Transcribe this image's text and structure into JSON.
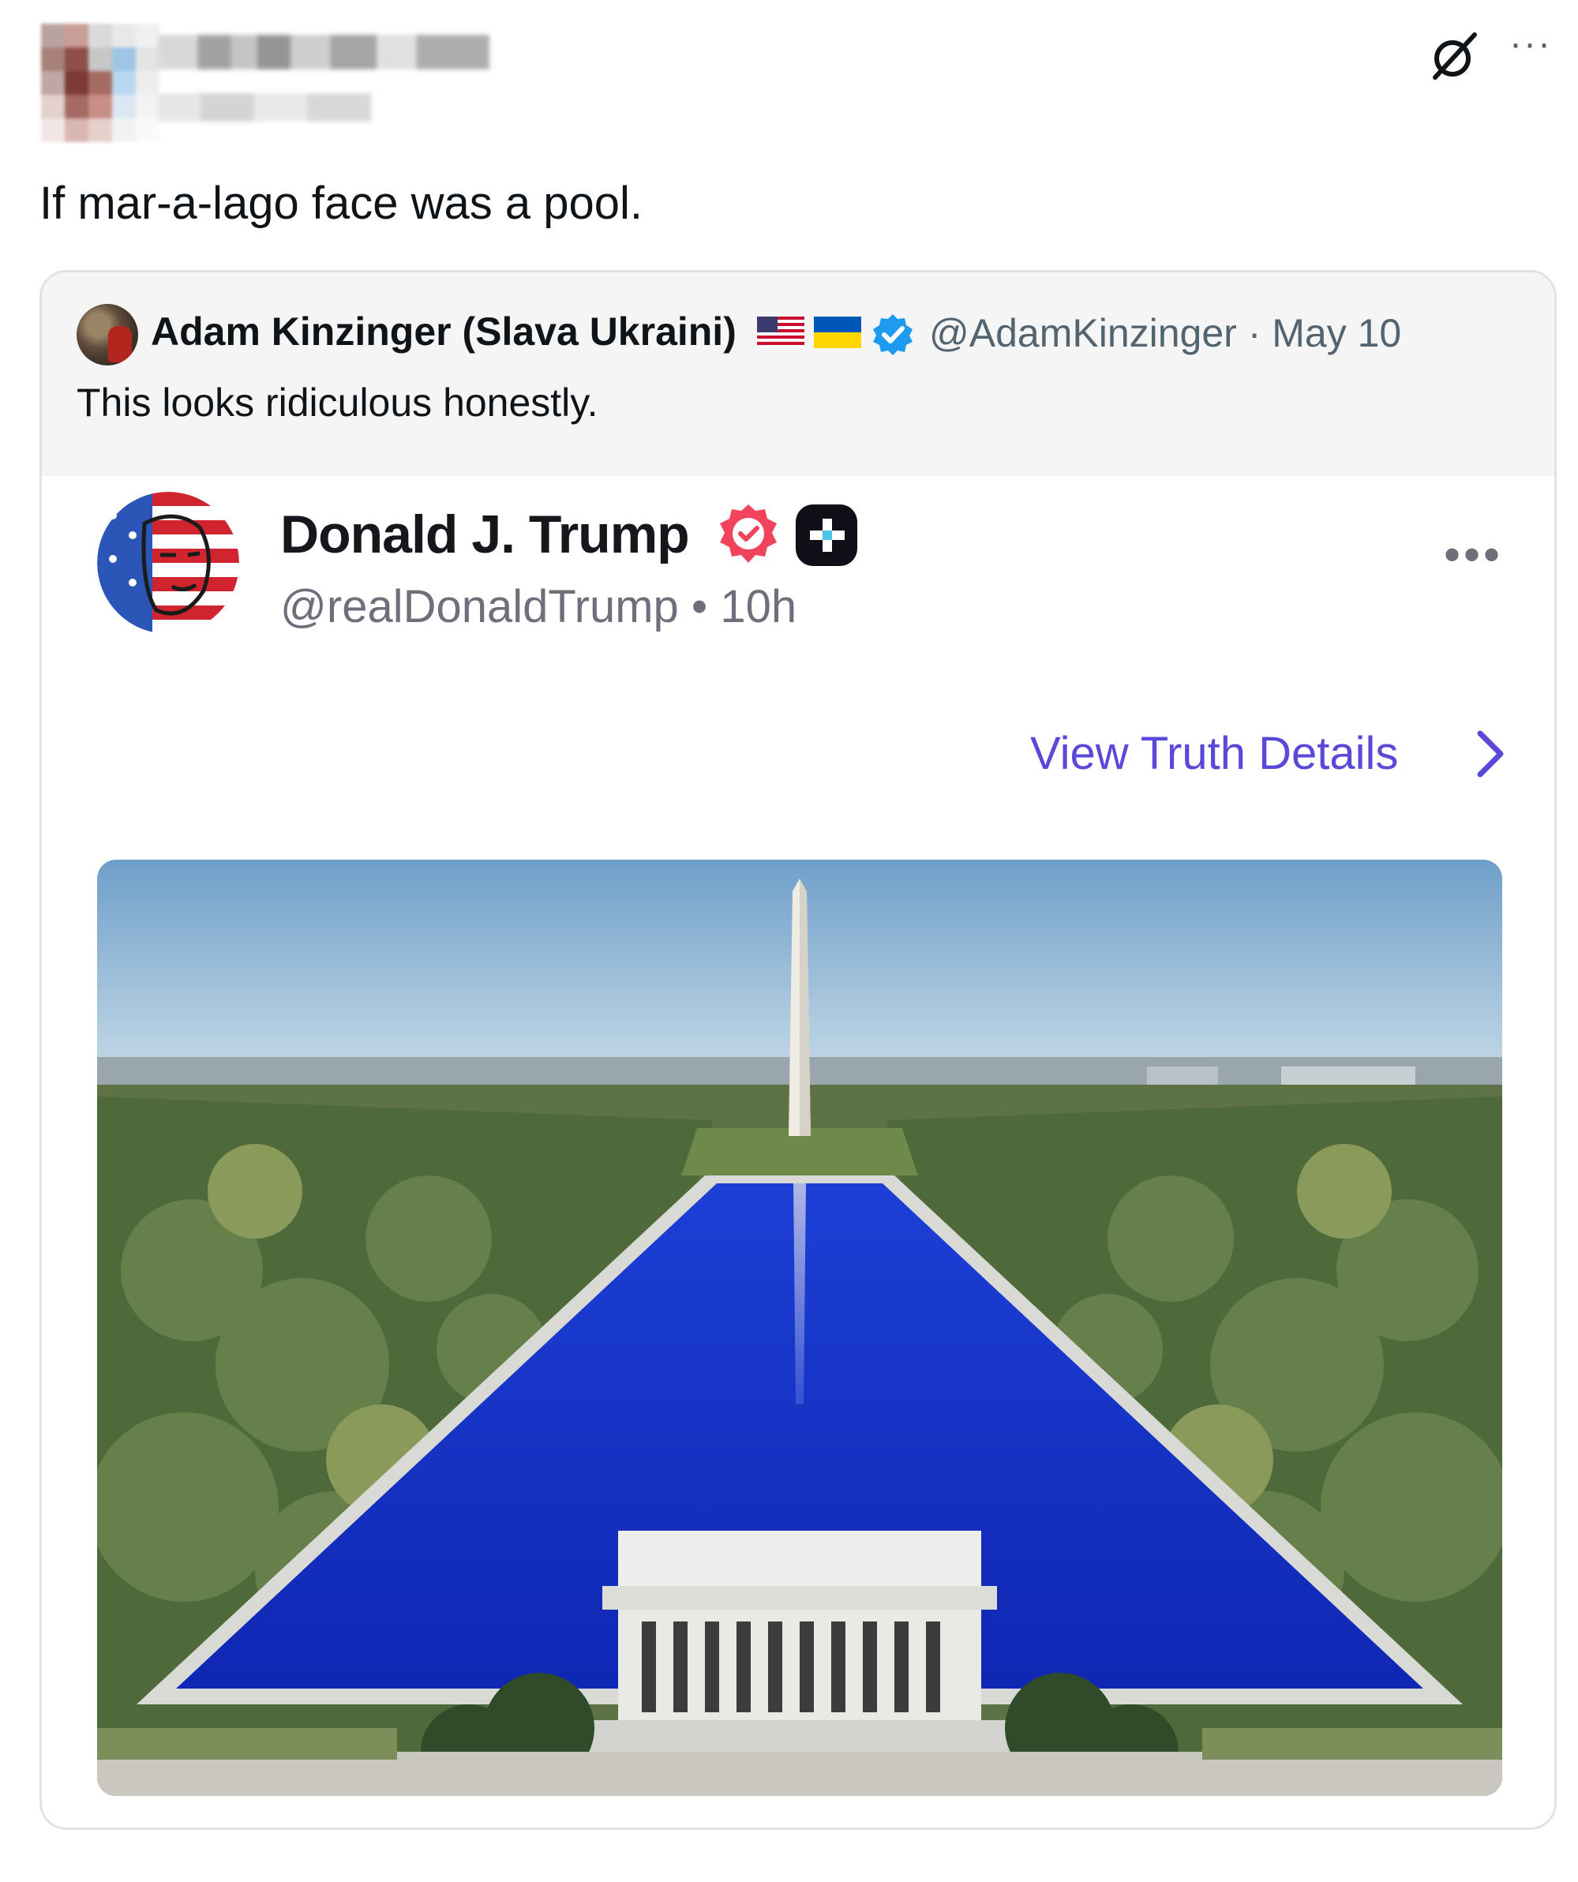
{
  "tweet": {
    "text": "If mar-a-lago face was a pool."
  },
  "quoted_tweet": {
    "author_name": "Adam Kinzinger (Slava Ukraini)",
    "handle_date": "@AdamKinzinger · May 10",
    "text": "This looks ridiculous honestly."
  },
  "truth_post": {
    "author_name": "Donald J. Trump",
    "handle_time": "@realDonaldTrump • 10h",
    "view_details": "View Truth Details"
  },
  "colors": {
    "verified_blue": "#1d9bf0",
    "truth_badge": "#f1435c",
    "truth_link": "#5a49d9",
    "pool_blue": "#1430c8"
  },
  "icons": [
    "grok-icon",
    "more-icon",
    "us-flag-icon",
    "ukraine-flag-icon",
    "verified-icon",
    "truth-verified-icon",
    "truth-plus-icon",
    "chevron-right-icon"
  ]
}
